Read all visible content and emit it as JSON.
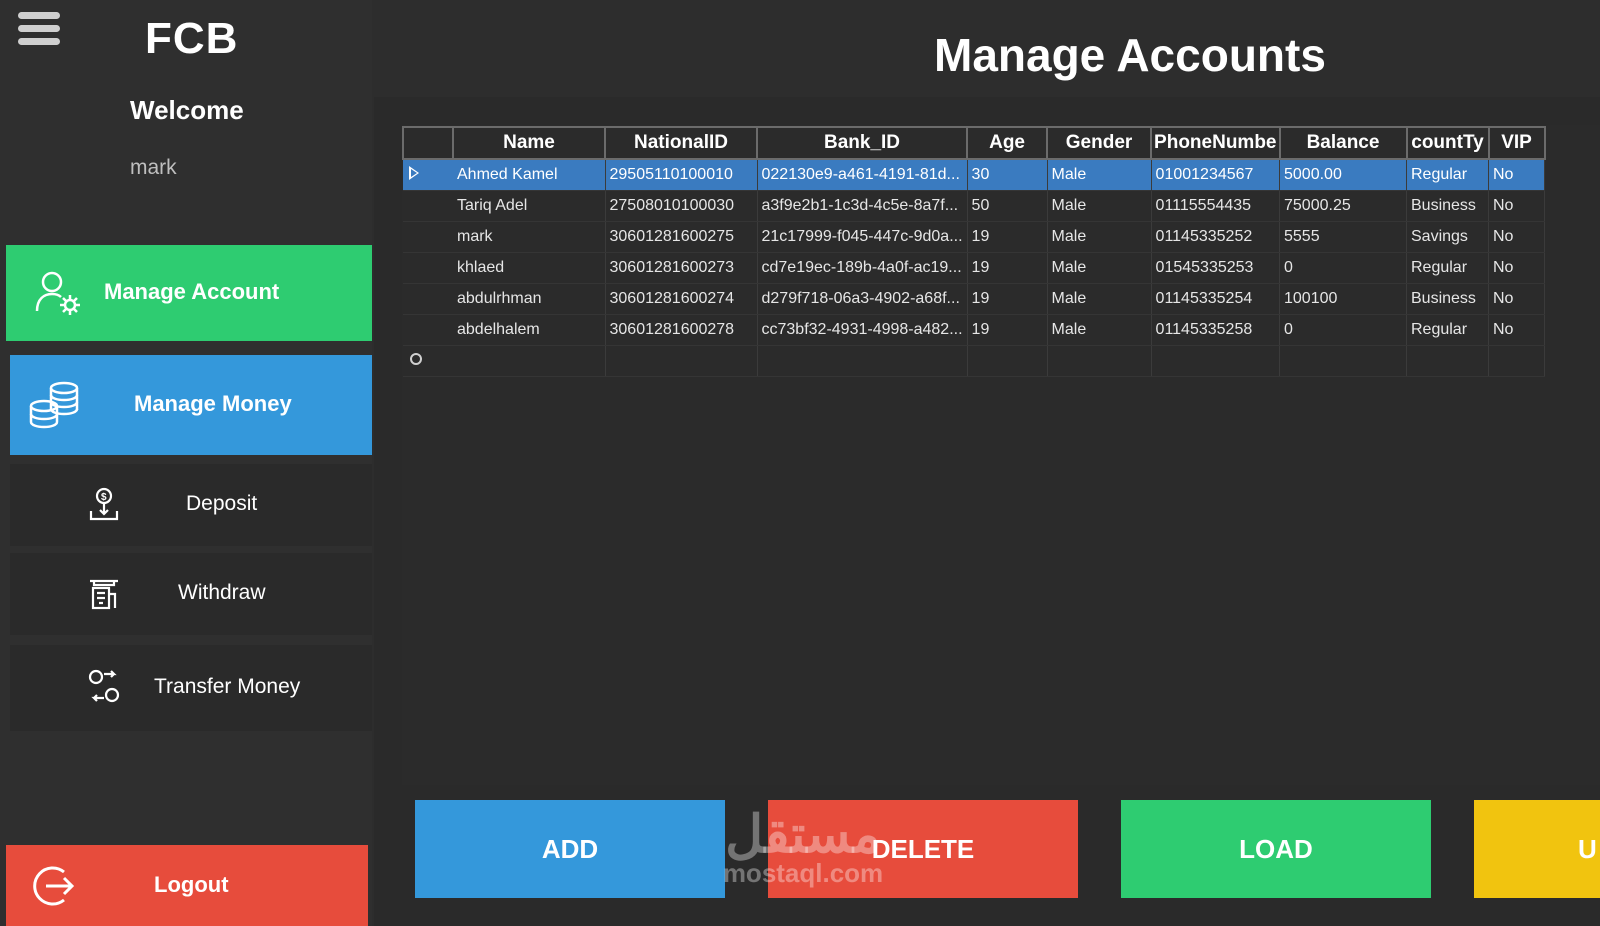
{
  "app": {
    "brand": "FCB",
    "title": "Manage Accounts"
  },
  "sidebar": {
    "welcome": "Welcome",
    "username": "mark",
    "manage_account": "Manage Account",
    "manage_money": "Manage Money",
    "deposit": "Deposit",
    "withdraw": "Withdraw",
    "transfer": "Transfer Money",
    "logout": "Logout"
  },
  "grid": {
    "columns": [
      "Name",
      "NationalID",
      "Bank_ID",
      "Age",
      "Gender",
      "PhoneNumbe",
      "Balance",
      "countTy",
      "VIP"
    ],
    "rows": [
      [
        "Ahmed Kamel",
        "29505110100010",
        "022130e9-a461-4191-81d...",
        "30",
        "Male",
        "01001234567",
        "5000.00",
        "Regular",
        "No"
      ],
      [
        "Tariq Adel",
        "27508010100030",
        "a3f9e2b1-1c3d-4c5e-8a7f...",
        "50",
        "Male",
        "01115554435",
        "75000.25",
        "Business",
        "No"
      ],
      [
        "mark",
        "30601281600275",
        "21c17999-f045-447c-9d0a...",
        "19",
        "Male",
        "01145335252",
        "5555",
        "Savings",
        "No"
      ],
      [
        "khlaed",
        "30601281600273",
        "cd7e19ec-189b-4a0f-ac19...",
        "19",
        "Male",
        "01545335253",
        "0",
        "Regular",
        "No"
      ],
      [
        "abdulrhman",
        "30601281600274",
        "d279f718-06a3-4902-a68f...",
        "19",
        "Male",
        "01145335254",
        "100100",
        "Business",
        "No"
      ],
      [
        "abdelhalem",
        "30601281600278",
        "cc73bf32-4931-4998-a482...",
        "19",
        "Male",
        "01145335258",
        "0",
        "Regular",
        "No"
      ]
    ],
    "selected_row": 0
  },
  "actions": {
    "add": "ADD",
    "delete": "DELETE",
    "load": "LOAD",
    "update": "U"
  },
  "watermark": {
    "arabic": "مستقل",
    "latin": "mostaql.com"
  },
  "colors": {
    "green": "#2ecc71",
    "blue": "#3498db",
    "red": "#e74c3c",
    "yellow": "#f1c40f",
    "selection": "#3a7bc0"
  }
}
